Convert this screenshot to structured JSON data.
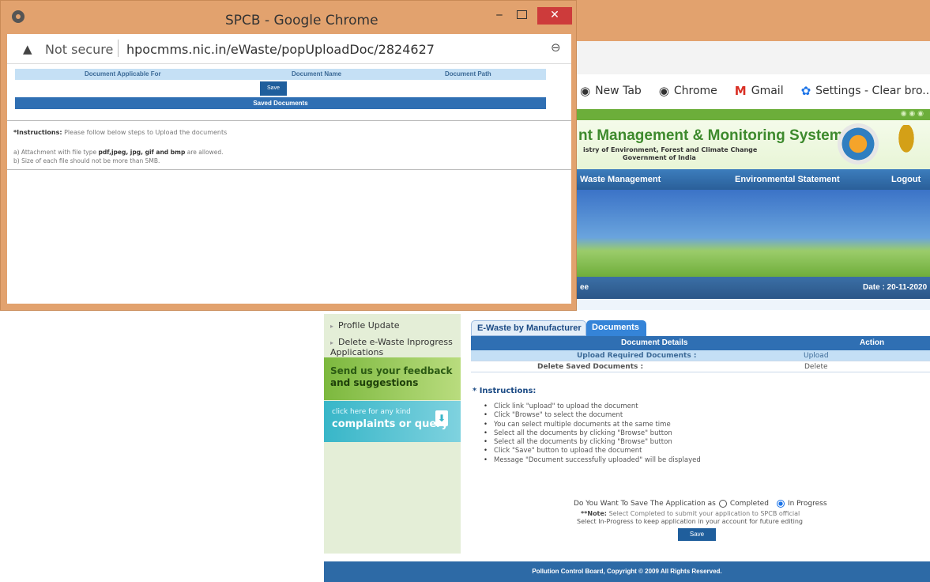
{
  "background": {
    "bookmarks": [
      {
        "icon": "chrome-icon",
        "label": "New Tab"
      },
      {
        "icon": "chrome-icon",
        "label": "Chrome"
      },
      {
        "icon": "gmail-icon",
        "label": "Gmail"
      },
      {
        "icon": "gear-icon",
        "label": "Settings - Clear bro..."
      }
    ],
    "site": {
      "title": "nt Management & Monitoring System",
      "subtitle1": "istry of Environment, Forest and Climate Change",
      "subtitle2": "Government of India",
      "nav": [
        "Waste Management",
        "Environmental Statement",
        "Logout"
      ],
      "datebar_left": "ee",
      "datebar_right": "Date : 20-11-2020"
    },
    "left_menu": {
      "profile_update": "Profile Update",
      "delete_inprogress": "Delete e-Waste Inprogress Applications",
      "feedback_line1": "Send us your feedback",
      "feedback_line2": "and suggestions",
      "complaints_line1": "click here for any kind",
      "complaints_line2": "complaints or query"
    },
    "tabs": [
      "E-Waste by Manufacturer",
      "Documents"
    ],
    "doc_table": {
      "headers": [
        "Document Details",
        "Action"
      ],
      "rows": [
        {
          "label": "Upload Required Documents :",
          "action": "Upload"
        },
        {
          "label": "Delete Saved Documents :",
          "action": "Delete"
        }
      ]
    },
    "instructions_title": "* Instructions:",
    "instructions": [
      "Click link \"upload\" to upload the document",
      "Click \"Browse\" to select the document",
      "You can select multiple documents at the same time",
      "Select all the documents by clicking \"Browse\" button",
      "Select all the documents by clicking \"Browse\" button",
      "Click \"Save\" button to upload the document",
      "Message \"Document successfully uploaded\" will be displayed"
    ],
    "save_question": "Do You Want To Save The Application as",
    "radio_completed": "Completed",
    "radio_inprogress": "In Progress",
    "note_label": "**Note:",
    "note_line1": "Select Completed to submit your application to SPCB official",
    "note_line2": "Select In-Progress to keep application in your account for future editing",
    "save_button": "Save",
    "footer": "Pollution Control Board, Copyright © 2009 All Rights Reserved."
  },
  "popup": {
    "window_title": "SPCB - Google Chrome",
    "not_secure": "Not secure",
    "url": "hpocmms.nic.in/eWaste/popUploadDoc/2824627",
    "table_headers": [
      "Document Applicable For",
      "Document Name",
      "Document Path"
    ],
    "save_button": "Save",
    "saved_documents": "Saved Documents",
    "instructions_label": "*Instructions:",
    "instructions_text": "Please follow below steps to Upload the documents",
    "point_a_prefix": "a) Attachment with file type",
    "point_a_types": "pdf,jpeg, jpg, gif and bmp",
    "point_a_suffix": "are allowed.",
    "point_b": "b) Size of each file should not be more than 5MB."
  }
}
